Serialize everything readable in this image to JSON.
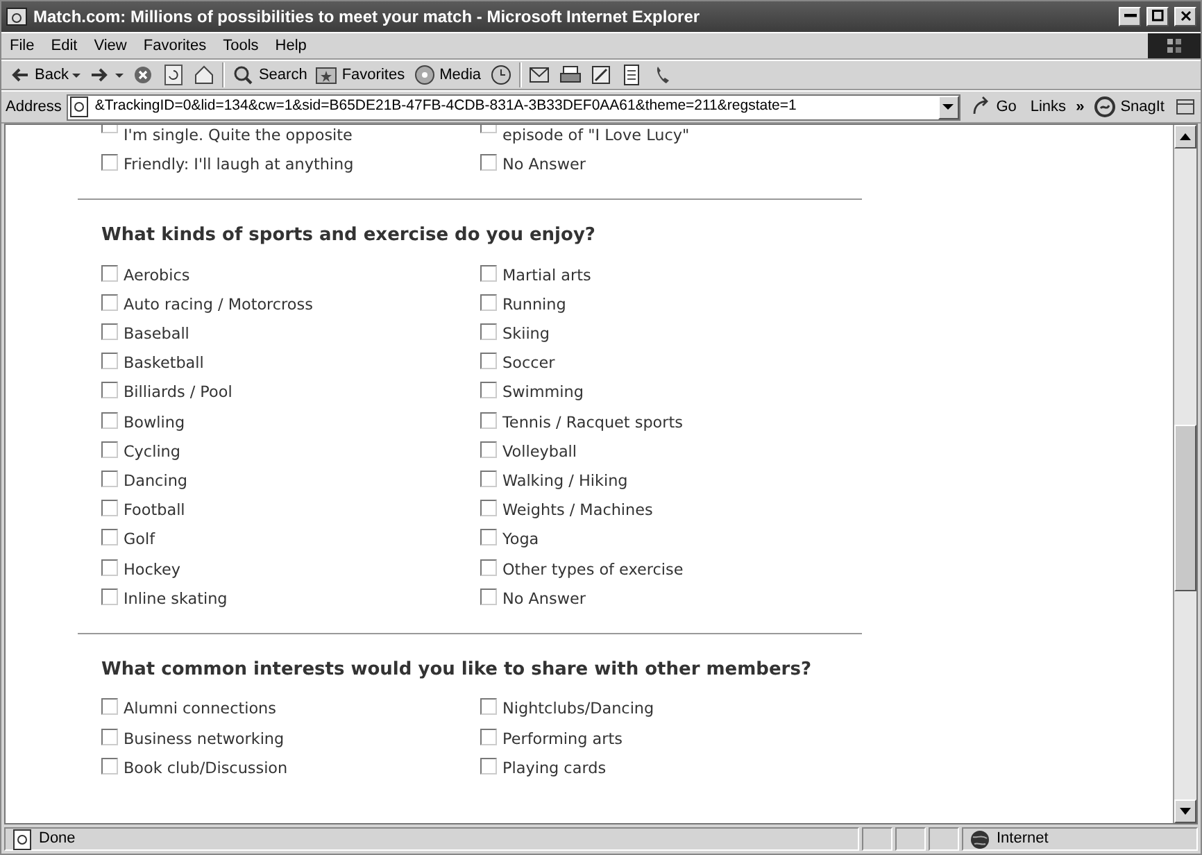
{
  "window": {
    "title": "Match.com: Millions of possibilities to meet your match - Microsoft Internet Explorer"
  },
  "menu": [
    "File",
    "Edit",
    "View",
    "Favorites",
    "Tools",
    "Help"
  ],
  "toolbar": [
    {
      "kind": "back",
      "label": "Back"
    },
    {
      "kind": "forward"
    },
    {
      "kind": "stop"
    },
    {
      "kind": "refresh"
    },
    {
      "kind": "home"
    },
    {
      "kind": "search",
      "label": "Search"
    },
    {
      "kind": "favorites",
      "label": "Favorites"
    },
    {
      "kind": "media",
      "label": "Media"
    },
    {
      "kind": "history"
    },
    {
      "kind": "mail"
    },
    {
      "kind": "print"
    },
    {
      "kind": "edit"
    },
    {
      "kind": "discuss"
    },
    {
      "kind": "messenger"
    }
  ],
  "address": {
    "label": "Address",
    "url": "&TrackingID=0&lid=134&cw=1&sid=B65DE21B-47FB-4CDB-831A-3B33DEF0AA61&theme=211&regstate=1",
    "go": "Go",
    "links": "Links",
    "links_more": "»",
    "snagit": "SnagIt"
  },
  "partial_section": {
    "left": [
      {
        "label": "I'm single. Quite the opposite",
        "checked": false
      },
      {
        "label": "Friendly: I'll laugh at anything",
        "checked": false
      }
    ],
    "right": [
      {
        "label": "episode of \"I Love Lucy\"",
        "checked": false
      },
      {
        "label": "No Answer",
        "checked": false
      }
    ]
  },
  "sections": [
    {
      "question": "What kinds of sports and exercise do you enjoy?",
      "left": [
        {
          "label": "Aerobics",
          "checked": false
        },
        {
          "label": "Auto racing / Motorcross",
          "checked": false
        },
        {
          "label": "Baseball",
          "checked": false
        },
        {
          "label": "Basketball",
          "checked": false
        },
        {
          "label": "Billiards / Pool",
          "checked": false
        },
        {
          "label": "Bowling",
          "checked": false
        },
        {
          "label": "Cycling",
          "checked": false
        },
        {
          "label": "Dancing",
          "checked": false
        },
        {
          "label": "Football",
          "checked": false
        },
        {
          "label": "Golf",
          "checked": false
        },
        {
          "label": "Hockey",
          "checked": false
        },
        {
          "label": "Inline skating",
          "checked": false
        }
      ],
      "right": [
        {
          "label": "Martial arts",
          "checked": false
        },
        {
          "label": "Running",
          "checked": false
        },
        {
          "label": "Skiing",
          "checked": false
        },
        {
          "label": "Soccer",
          "checked": false
        },
        {
          "label": "Swimming",
          "checked": false
        },
        {
          "label": "Tennis / Racquet sports",
          "checked": false
        },
        {
          "label": "Volleyball",
          "checked": false
        },
        {
          "label": "Walking / Hiking",
          "checked": false
        },
        {
          "label": "Weights / Machines",
          "checked": false
        },
        {
          "label": "Yoga",
          "checked": false
        },
        {
          "label": "Other types of exercise",
          "checked": false
        },
        {
          "label": "No Answer",
          "checked": false
        }
      ]
    },
    {
      "question": "What common interests would you like to share with other members?",
      "left": [
        {
          "label": "Alumni connections",
          "checked": false
        },
        {
          "label": "Business networking",
          "checked": false
        },
        {
          "label": "Book club/Discussion",
          "checked": false
        }
      ],
      "right": [
        {
          "label": "Nightclubs/Dancing",
          "checked": false
        },
        {
          "label": "Performing arts",
          "checked": false
        },
        {
          "label": "Playing cards",
          "checked": false
        }
      ]
    }
  ],
  "status": {
    "text": "Done",
    "zone": "Internet"
  }
}
